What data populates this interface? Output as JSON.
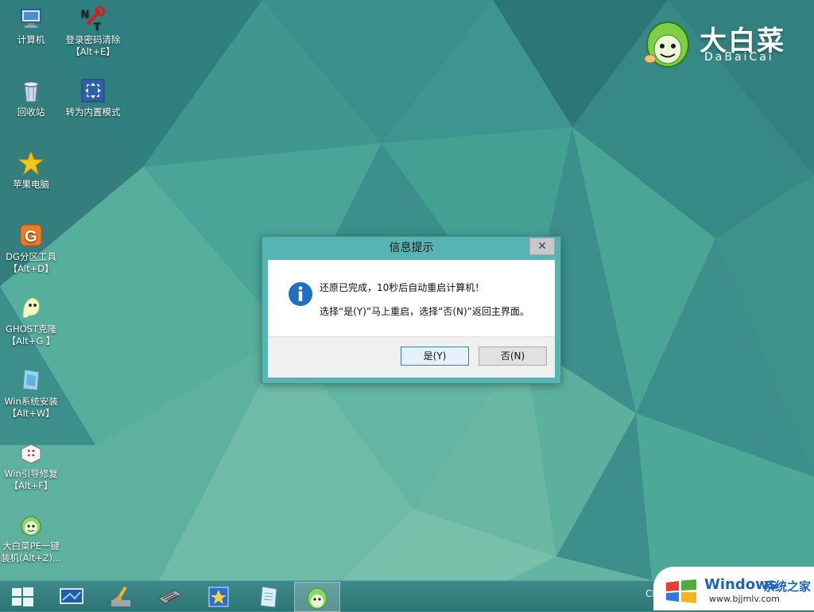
{
  "desktop": {
    "icons": [
      {
        "label": "计算机",
        "icon": "computer-icon"
      },
      {
        "label": "登录密码清除\n【Alt+E】",
        "icon": "password-clear-icon"
      },
      {
        "label": "回收站",
        "icon": "recycle-bin-icon"
      },
      {
        "label": "转为内置模式",
        "icon": "builtin-mode-icon"
      },
      {
        "label": "苹果电脑",
        "icon": "star-icon"
      },
      {
        "label": "DG分区工具\n【Alt+D】",
        "icon": "diskgenius-icon"
      },
      {
        "label": "GHOST克隆\n【Alt+G 】",
        "icon": "ghost-icon"
      },
      {
        "label": "Win系统安装\n【Alt+W】",
        "icon": "win-install-icon"
      },
      {
        "label": "Win引导修复\n【Alt+F】",
        "icon": "boot-repair-icon"
      },
      {
        "label": "大白菜PE一键\n装机(Alt+Z)...",
        "icon": "dabaicai-install-icon"
      }
    ]
  },
  "brand": {
    "name_cn": "大白菜",
    "name_en": "DaBaiCai"
  },
  "dialog": {
    "title": "信息提示",
    "close_label": "✕",
    "message_line1": "还原已完成，10秒后自动重启计算机！",
    "message_line2": "选择“是(Y)”马上重启，选择“否(N)”返回主界面。",
    "yes_label": "是(Y)",
    "no_label": "否(N)"
  },
  "taskbar": {
    "items": [
      "start-icon",
      "display-icon",
      "cleaner-icon",
      "memory-icon",
      "tools-icon",
      "notepad-icon",
      "dabaicai-icon"
    ],
    "tray_text": "CN"
  },
  "watermark": {
    "brand": "Windows",
    "suffix": "系统之家",
    "url": "www.bjjmlv.com"
  },
  "colors": {
    "accent": "#58b3b3",
    "desktop": "#3c8f8b",
    "taskbar": "#347d7d"
  }
}
